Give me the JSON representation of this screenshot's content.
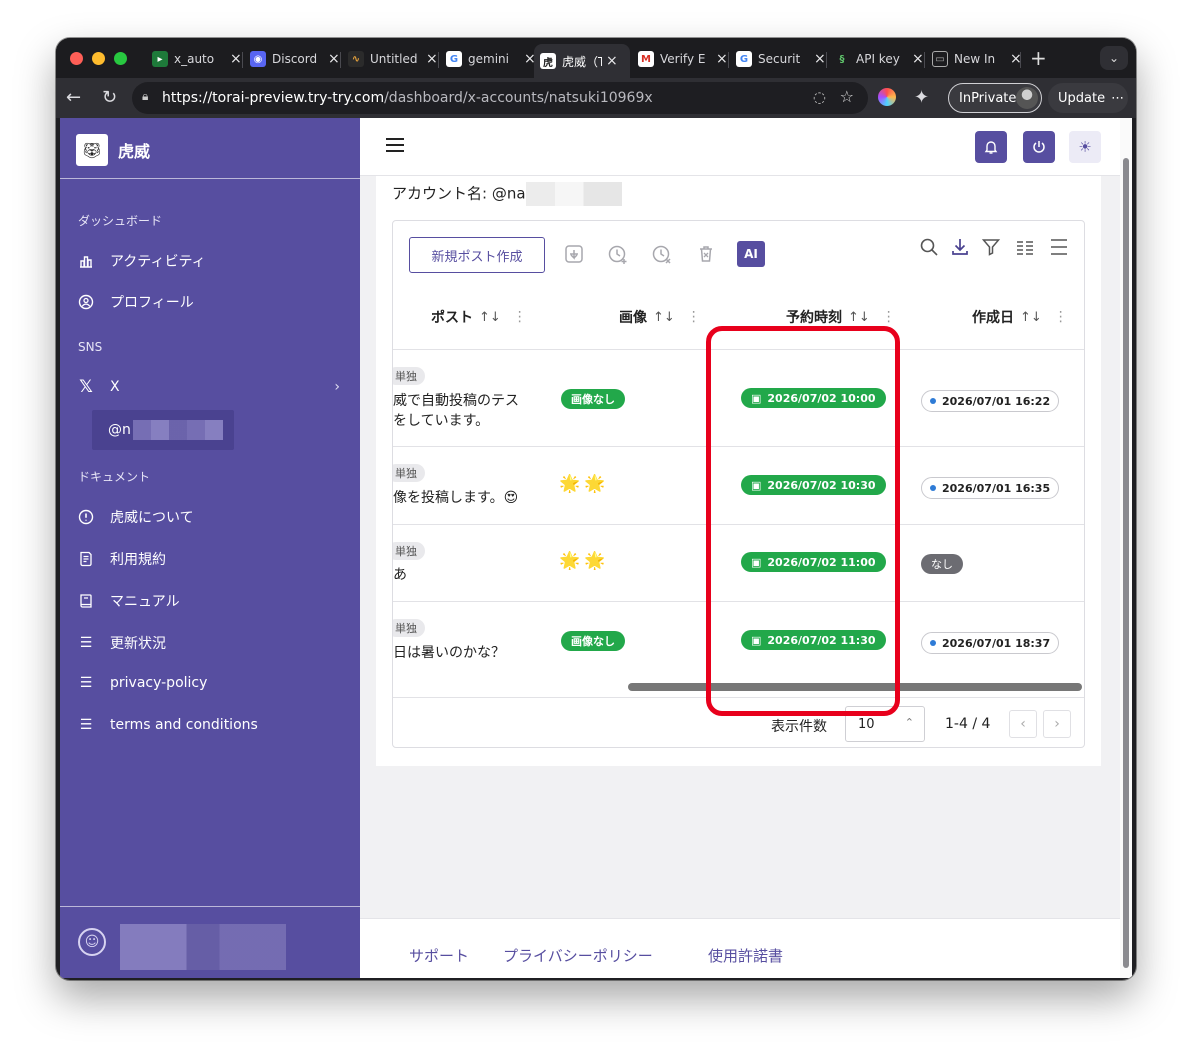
{
  "browser": {
    "tabs": [
      {
        "label": "x_auto",
        "icon": "terminal-icon",
        "color": "#1e7a3a"
      },
      {
        "label": "Discord",
        "icon": "discord-icon",
        "color": "#5865f2"
      },
      {
        "label": "Untitled",
        "icon": "chart-icon",
        "color": "#2b2b2b"
      },
      {
        "label": "gemini",
        "icon": "google-icon",
        "color": "#ffffff"
      },
      {
        "label": "虎威（T",
        "icon": "torai-icon",
        "color": "#ffffff"
      },
      {
        "label": "Verify E",
        "icon": "gmail-icon",
        "color": "#ffffff"
      },
      {
        "label": "Securit",
        "icon": "google-icon",
        "color": "#ffffff"
      },
      {
        "label": "API key",
        "icon": "api-icon",
        "color": "#3a6"
      },
      {
        "label": "New In",
        "icon": "newtab-icon",
        "color": "#444"
      }
    ],
    "url_host": "https://torai-preview.try-try.com",
    "url_path": "/dashboard/x-accounts/natsuki10969x",
    "inprivate_label": "InPrivate",
    "update_label": "Update"
  },
  "sidebar": {
    "brand": "虎威",
    "sections": {
      "dashboard": "ダッシュボード",
      "sns": "SNS",
      "docs": "ドキュメント"
    },
    "items": {
      "activity": "アクティビティ",
      "profile": "プロフィール",
      "x": "X",
      "account": "@n",
      "about": "虎威について",
      "terms": "利用規約",
      "manual": "マニュアル",
      "updates": "更新状況",
      "privacy": "privacy-policy",
      "conditions": "terms and conditions"
    }
  },
  "main": {
    "account_label": "アカウント名: @na",
    "new_post": "新規ポスト作成",
    "ai_label": "AI",
    "columns": {
      "post": "ポスト",
      "image": "画像",
      "scheduled": "予約時刻",
      "created": "作成日"
    },
    "sort_symbol": "↑↓",
    "rows": [
      {
        "tag": "単独",
        "text": "威で自動投稿のテスをしています。",
        "image": "画像なし",
        "scheduled": "2026/07/02 10:00",
        "created": "2026/07/01 16:22"
      },
      {
        "tag": "単独",
        "text": "像を投稿します。😍",
        "image": "🌟🌟",
        "scheduled": "2026/07/02 10:30",
        "created": "2026/07/01 16:35"
      },
      {
        "tag": "単独",
        "text": "あ",
        "image": "🌟🌟",
        "scheduled": "2026/07/02 11:00",
        "created": "なし"
      },
      {
        "tag": "単独",
        "text": "日は暑いのかな？",
        "image": "画像なし",
        "scheduled": "2026/07/02 11:30",
        "created": "2026/07/01 18:37"
      }
    ],
    "pager": {
      "label": "表示件数",
      "per_page": "10",
      "range": "1-4 / 4"
    }
  },
  "footer": {
    "support": "サポート",
    "privacy": "プライバシーポリシー",
    "license": "使用許諾書"
  },
  "colors": {
    "brand": "#574ea0",
    "green": "#22a84a",
    "highlight": "#e8001c"
  }
}
